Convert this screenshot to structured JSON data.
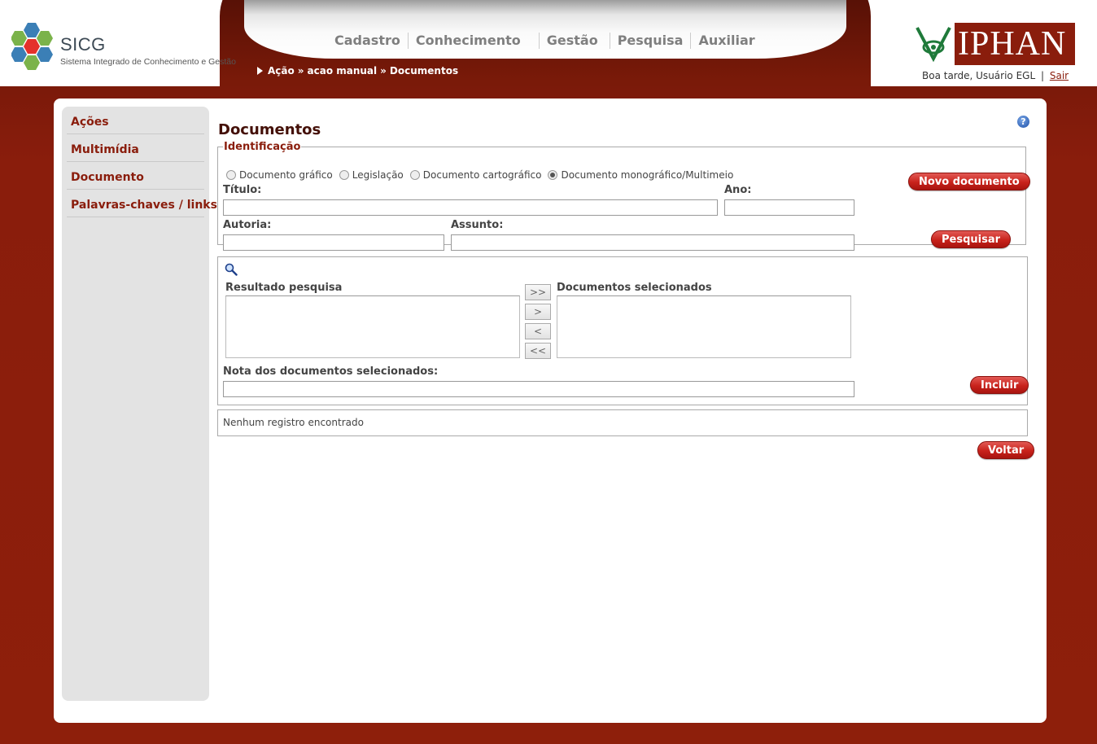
{
  "header": {
    "app_name": "SICG",
    "app_subtitle": "Sistema Integrado de Conhecimento e Gestão",
    "nav": [
      "Cadastro",
      "Conhecimento",
      "Gestão",
      "Pesquisa",
      "Auxiliar"
    ],
    "breadcrumb": [
      "Ação",
      "acao manual",
      "Documentos"
    ],
    "breadcrumb_separator": "»",
    "org_logo_text": "IPHAN",
    "greeting": "Boa tarde, Usuário EGL",
    "greeting_sep": "|",
    "logout": "Sair"
  },
  "sidebar": {
    "items": [
      "Ações",
      "Multimídia",
      "Documento",
      "Palavras-chaves / links"
    ]
  },
  "main": {
    "title": "Documentos",
    "help_icon": "?",
    "identificacao": {
      "legend": "Identificação",
      "radios": [
        {
          "label": "Documento gráfico",
          "checked": false
        },
        {
          "label": "Legislação",
          "checked": false
        },
        {
          "label": "Documento cartográfico",
          "checked": false
        },
        {
          "label": "Documento monográfico/Multimeio",
          "checked": true
        }
      ],
      "titulo_label": "Título:",
      "titulo_value": "",
      "ano_label": "Ano:",
      "ano_value": "",
      "autoria_label": "Autoria:",
      "autoria_value": "",
      "assunto_label": "Assunto:",
      "assunto_value": "",
      "novo_documento": "Novo documento",
      "pesquisar": "Pesquisar"
    },
    "selecao": {
      "resultado_label": "Resultado pesquisa",
      "selecionados_label": "Documentos selecionados",
      "move_all_right": ">>",
      "move_right": ">",
      "move_left": "<",
      "move_all_left": "<<",
      "nota_label": "Nota dos documentos selecionados:",
      "nota_value": "",
      "incluir": "Incluir"
    },
    "results_text": "Nenhum registro encontrado",
    "voltar": "Voltar"
  },
  "colors": {
    "brand_red": "#8a1d0c",
    "button_red": "#c8221b"
  }
}
